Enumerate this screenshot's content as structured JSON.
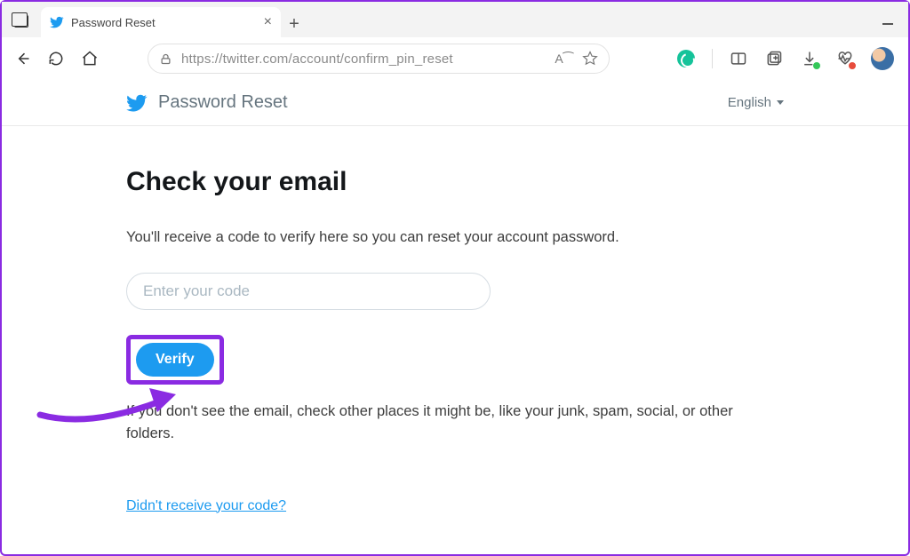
{
  "browser": {
    "tab_title": "Password Reset",
    "url": "https://twitter.com/account/confirm_pin_reset",
    "read_aloud": "A⁀",
    "icons": {
      "back": "back-icon",
      "refresh": "refresh-icon",
      "home": "home-icon",
      "lock": "lock-icon",
      "favorite": "star-icon",
      "grammarly": "grammarly-icon",
      "split": "split-screen-icon",
      "collections": "collections-icon",
      "downloads": "download-icon",
      "health": "heart-rate-icon",
      "avatar": "profile-avatar"
    }
  },
  "header": {
    "title": "Password Reset",
    "language": "English"
  },
  "main": {
    "heading": "Check your email",
    "subtext": "You'll receive a code to verify here so you can reset your account password.",
    "code_placeholder": "Enter your code",
    "verify_label": "Verify",
    "help_text": "If you don't see the email, check other places it might be, like your junk, spam, social, or other folders.",
    "resend_link": "Didn't receive your code?"
  },
  "annotation": {
    "arrow_color": "#8a2be2",
    "highlight_color": "#8a2be2"
  }
}
